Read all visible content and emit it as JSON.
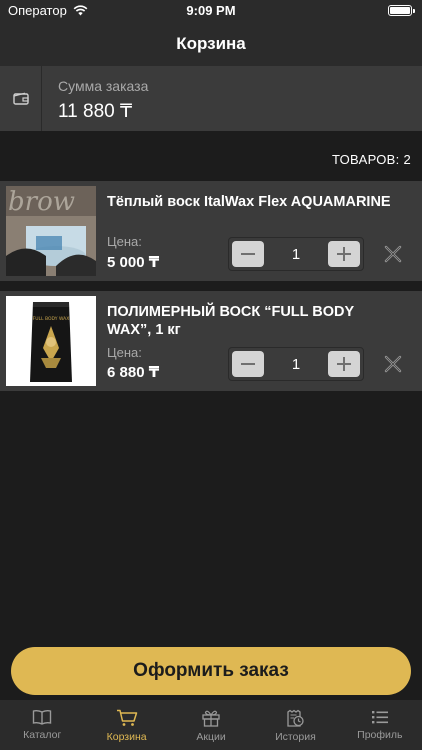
{
  "status_bar": {
    "carrier": "Оператор",
    "time": "9:09 PM"
  },
  "header": {
    "title": "Корзина"
  },
  "summary": {
    "label": "Сумма заказа",
    "value": "11 880 ₸"
  },
  "cart": {
    "count_label": "ТОВАРОВ: 2",
    "price_label": "Цена:",
    "items": [
      {
        "title": "Тёплый воск ItalWax Flex AQUAMARINE",
        "price": "5 000 ₸",
        "quantity": "1"
      },
      {
        "title": "ПОЛИМЕРНЫЙ ВОСК “FULL BODY WAX”, 1 кг",
        "price": "6 880 ₸",
        "quantity": "1"
      }
    ]
  },
  "checkout": {
    "label": "Оформить заказ"
  },
  "tabs": [
    {
      "label": "Каталог",
      "icon": "book-icon",
      "active": false
    },
    {
      "label": "Корзина",
      "icon": "cart-icon",
      "active": true
    },
    {
      "label": "Акции",
      "icon": "gift-icon",
      "active": false
    },
    {
      "label": "История",
      "icon": "history-icon",
      "active": false
    },
    {
      "label": "Профиль",
      "icon": "list-icon",
      "active": false
    }
  ],
  "colors": {
    "accent": "#dfb853",
    "background": "#1c1c1c",
    "card": "#3b3b3b",
    "bar": "#2b2b2b"
  }
}
